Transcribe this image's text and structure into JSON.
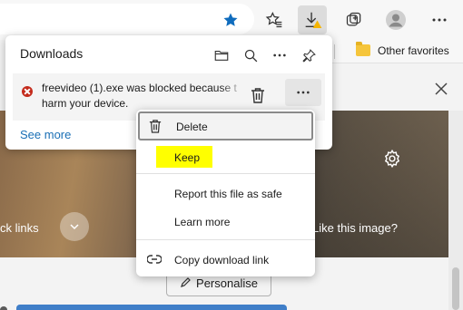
{
  "toolbar": {
    "buttons": [
      "favorite-star-icon",
      "favorites-icon",
      "downloads-icon",
      "collections-icon",
      "profile-avatar",
      "more-icon"
    ]
  },
  "favorites_bar": {
    "other_favorites_label": "Other favorites"
  },
  "page": {
    "quick_links_label": "ck links",
    "like_image_label": "Like this image?",
    "personalise_label": "Personalise"
  },
  "downloads": {
    "title": "Downloads",
    "item": {
      "line1": "freevideo (1).exe was blocked because t",
      "line2": "harm your device."
    },
    "see_more": "See more"
  },
  "context_menu": {
    "items": [
      {
        "label": "Delete",
        "icon": "trash-icon"
      },
      {
        "label": "Keep"
      },
      {
        "label": "Report this file as safe"
      },
      {
        "label": "Learn more"
      },
      {
        "label": "Copy download link",
        "icon": "link-icon"
      }
    ]
  },
  "colors": {
    "accent": "#1a6fb5",
    "star": "#0f6cbd",
    "error": "#c42b1c",
    "highlight": "#ffff00",
    "warning": "#f5b400"
  }
}
